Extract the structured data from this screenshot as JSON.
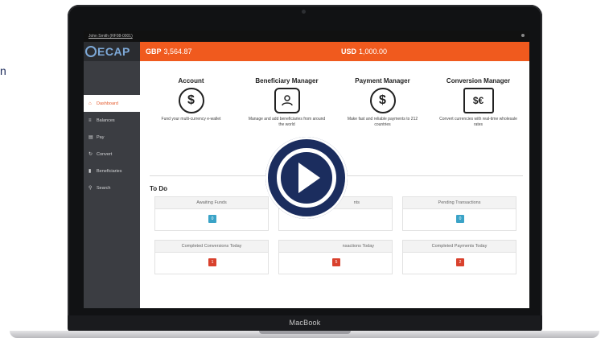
{
  "left_mark": "n",
  "laptop": {
    "brand": "MacBook"
  },
  "app": {
    "user_label": "John Smith (RF08-0001)",
    "logo_text": "ECAP",
    "balances": {
      "gbp_code": "GBP",
      "gbp_amount": "3,564.87",
      "usd_code": "USD",
      "usd_amount": "1,000.00"
    },
    "accent_color": "#f05a1e",
    "sidebar": {
      "items": [
        {
          "label": "Dashboard",
          "icon": "home-icon",
          "active": true
        },
        {
          "label": "Balances",
          "icon": "list-icon",
          "active": false
        },
        {
          "label": "Pay",
          "icon": "pay-icon",
          "active": false
        },
        {
          "label": "Convert",
          "icon": "refresh-icon",
          "active": false
        },
        {
          "label": "Beneficiaries",
          "icon": "book-icon",
          "active": false
        },
        {
          "label": "Search",
          "icon": "search-icon",
          "active": false
        }
      ]
    },
    "features": [
      {
        "title": "Account",
        "icon": "dollar-icon",
        "desc": "Fund your multi-currency e-wallet"
      },
      {
        "title": "Beneficiary Manager",
        "icon": "user-icon",
        "desc": "Manage and add beneficiaries from around the world"
      },
      {
        "title": "Payment Manager",
        "icon": "coins-icon",
        "desc": "Make fast and reliable payments to 212 countries"
      },
      {
        "title": "Conversion Manager",
        "icon": "exchange-icon",
        "desc": "Convert currencies with real-time wholesale rates"
      }
    ],
    "todo": {
      "title": "To Do",
      "cards": [
        {
          "label": "Awaiting Funds",
          "count": "0",
          "color": "#3aa3c7"
        },
        {
          "label": "nts",
          "count": "",
          "color": ""
        },
        {
          "label": "Pending Transactions",
          "count": "0",
          "color": "#3aa3c7"
        },
        {
          "label": "Completed Conversions Today",
          "count": "1",
          "color": "#d9412d"
        },
        {
          "label": "nsactions Today",
          "count": "5",
          "color": "#d9412d"
        },
        {
          "label": "Completed Payments Today",
          "count": "2",
          "color": "#d9412d"
        }
      ]
    }
  },
  "overlay": {
    "icon": "play-icon",
    "color": "#1b2d5e"
  }
}
